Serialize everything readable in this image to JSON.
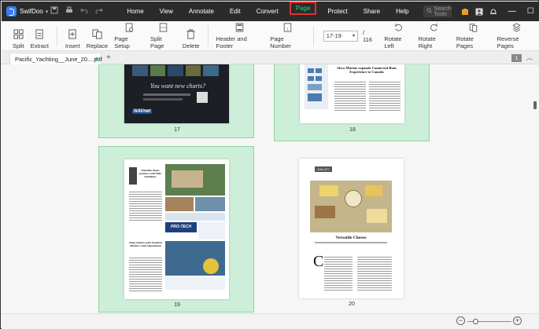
{
  "app": {
    "name": "SwifDoo",
    "menu": [
      "Home",
      "View",
      "Annotate",
      "Edit",
      "Convert",
      "Page",
      "Protect",
      "Share",
      "Help"
    ],
    "active_menu": "Page",
    "search_placeholder": "Search Tools",
    "win_min": "—",
    "win_max": "☐",
    "win_close": "✕"
  },
  "toolbar": {
    "split": "Split",
    "extract": "Extract",
    "insert": "Insert",
    "replace": "Replace",
    "page_setup": "Page Setup",
    "split_page": "Split Page",
    "delete": "Delete",
    "header_footer": "Header and Footer",
    "page_number": "Page Number",
    "page_range": "17-19",
    "page_total": "/ 116",
    "rotate_left": "Rotate Left",
    "rotate_right": "Rotate Right",
    "rotate_pages": "Rotate Pages",
    "reverse_pages": "Reverse Pages"
  },
  "tabs": {
    "doc_title": "Pacific_Yachting__June_20....pdf",
    "add": "+",
    "count": "1",
    "collapse": "︿"
  },
  "pages": [
    {
      "number": "17",
      "selected": true,
      "content": "You want new charts?"
    },
    {
      "number": "18",
      "selected": true,
      "content": "Sirco Marine expands Connected Boat Experience to Canada"
    },
    {
      "number": "19",
      "selected": true,
      "content": "Waterline Boats partners with NMS Stabilizers"
    },
    {
      "number": "20",
      "selected": false,
      "content": "Versatile Cheese"
    }
  ],
  "page_texts": {
    "p17_ad": "You want new charts?",
    "p17_brand": "NAVnet",
    "p18_headline": "Sirco Marine expands Connected Boat Experience to Canada",
    "p19_headline1": "Waterline Boats partners with NMS Stabilizers",
    "p19_headline2": "Doug Andrew joins Freedom Marine's Sales Department",
    "p19_ad": "PRO-TECH",
    "p20_label": "GALLEY",
    "p20_title": "Versatile Cheese",
    "p20_dropcap": "C"
  },
  "statusbar": {
    "zoom_out": "−",
    "zoom_in": "+",
    "zoom_level": 0.15
  },
  "colors": {
    "accent": "#2fd07a",
    "highlight_border": "#e03030",
    "selected_tile": "#cdeed8",
    "menubar_bg": "#2b2b2b"
  }
}
